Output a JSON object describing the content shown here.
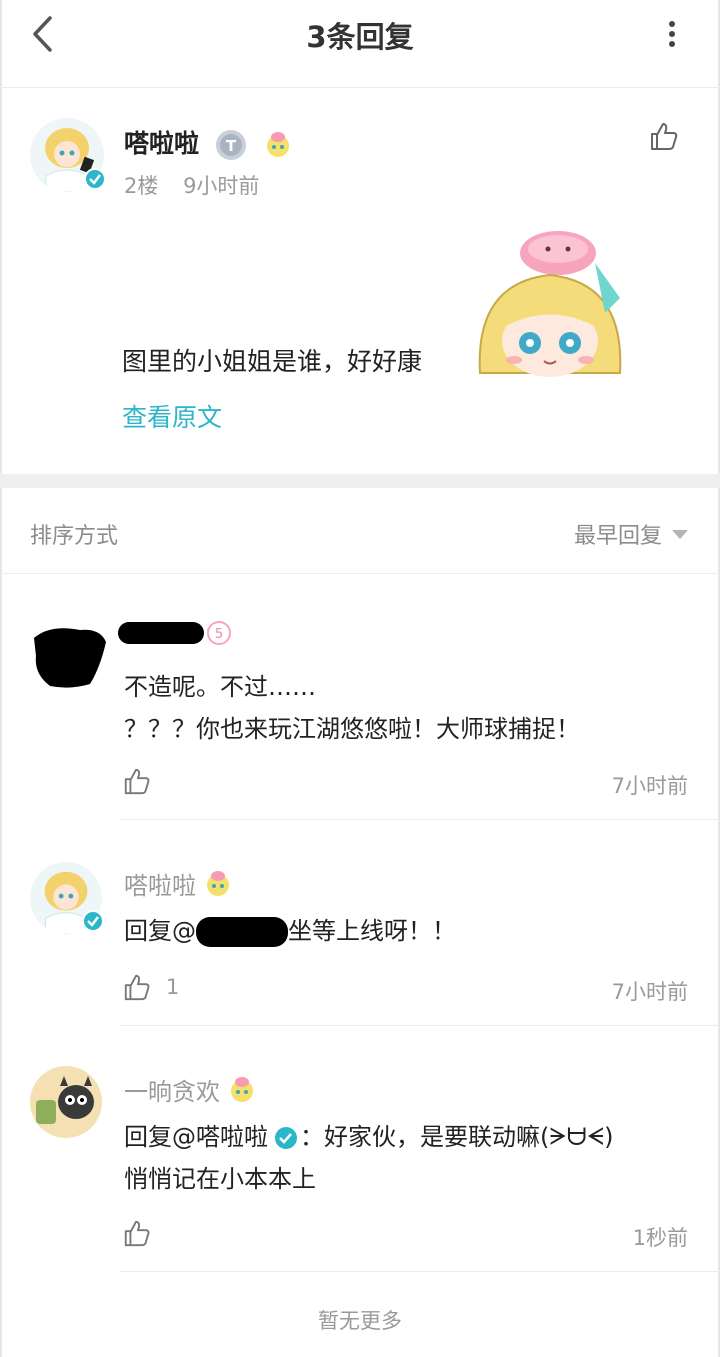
{
  "header": {
    "title": "3条回复",
    "back_icon": "chevron-left-icon",
    "more_icon": "more-vertical-icon"
  },
  "main_post": {
    "author": "嗒啦啦",
    "floor": "2楼",
    "time": "9小时前",
    "text": "图里的小姐姐是谁，好好康",
    "view_original": "查看原文"
  },
  "sort": {
    "label": "排序方式",
    "value": "最早回复"
  },
  "replies": [
    {
      "author": "",
      "line1": "不造呢。不过……",
      "line2": "？？？你也来玩江湖悠悠啦！大师球捕捉！",
      "likes": "",
      "time": "7小时前"
    },
    {
      "author": "嗒啦啦",
      "reply_prefix": "回复@",
      "reply_body": "坐等上线呀！！",
      "likes": "1",
      "time": "7小时前"
    },
    {
      "author": "一晌贪欢",
      "reply_prefix": "回复@嗒啦啦",
      "reply_body": "：好家伙，是要联动嘛(ᗒᗨᗕ)",
      "line2": "悄悄记在小本本上",
      "likes": "",
      "time": "1秒前"
    }
  ],
  "footer": {
    "no_more": "暂无更多"
  },
  "colors": {
    "accent": "#2bb6c9",
    "muted_text": "#9a9a9a",
    "divider": "#ececec"
  }
}
